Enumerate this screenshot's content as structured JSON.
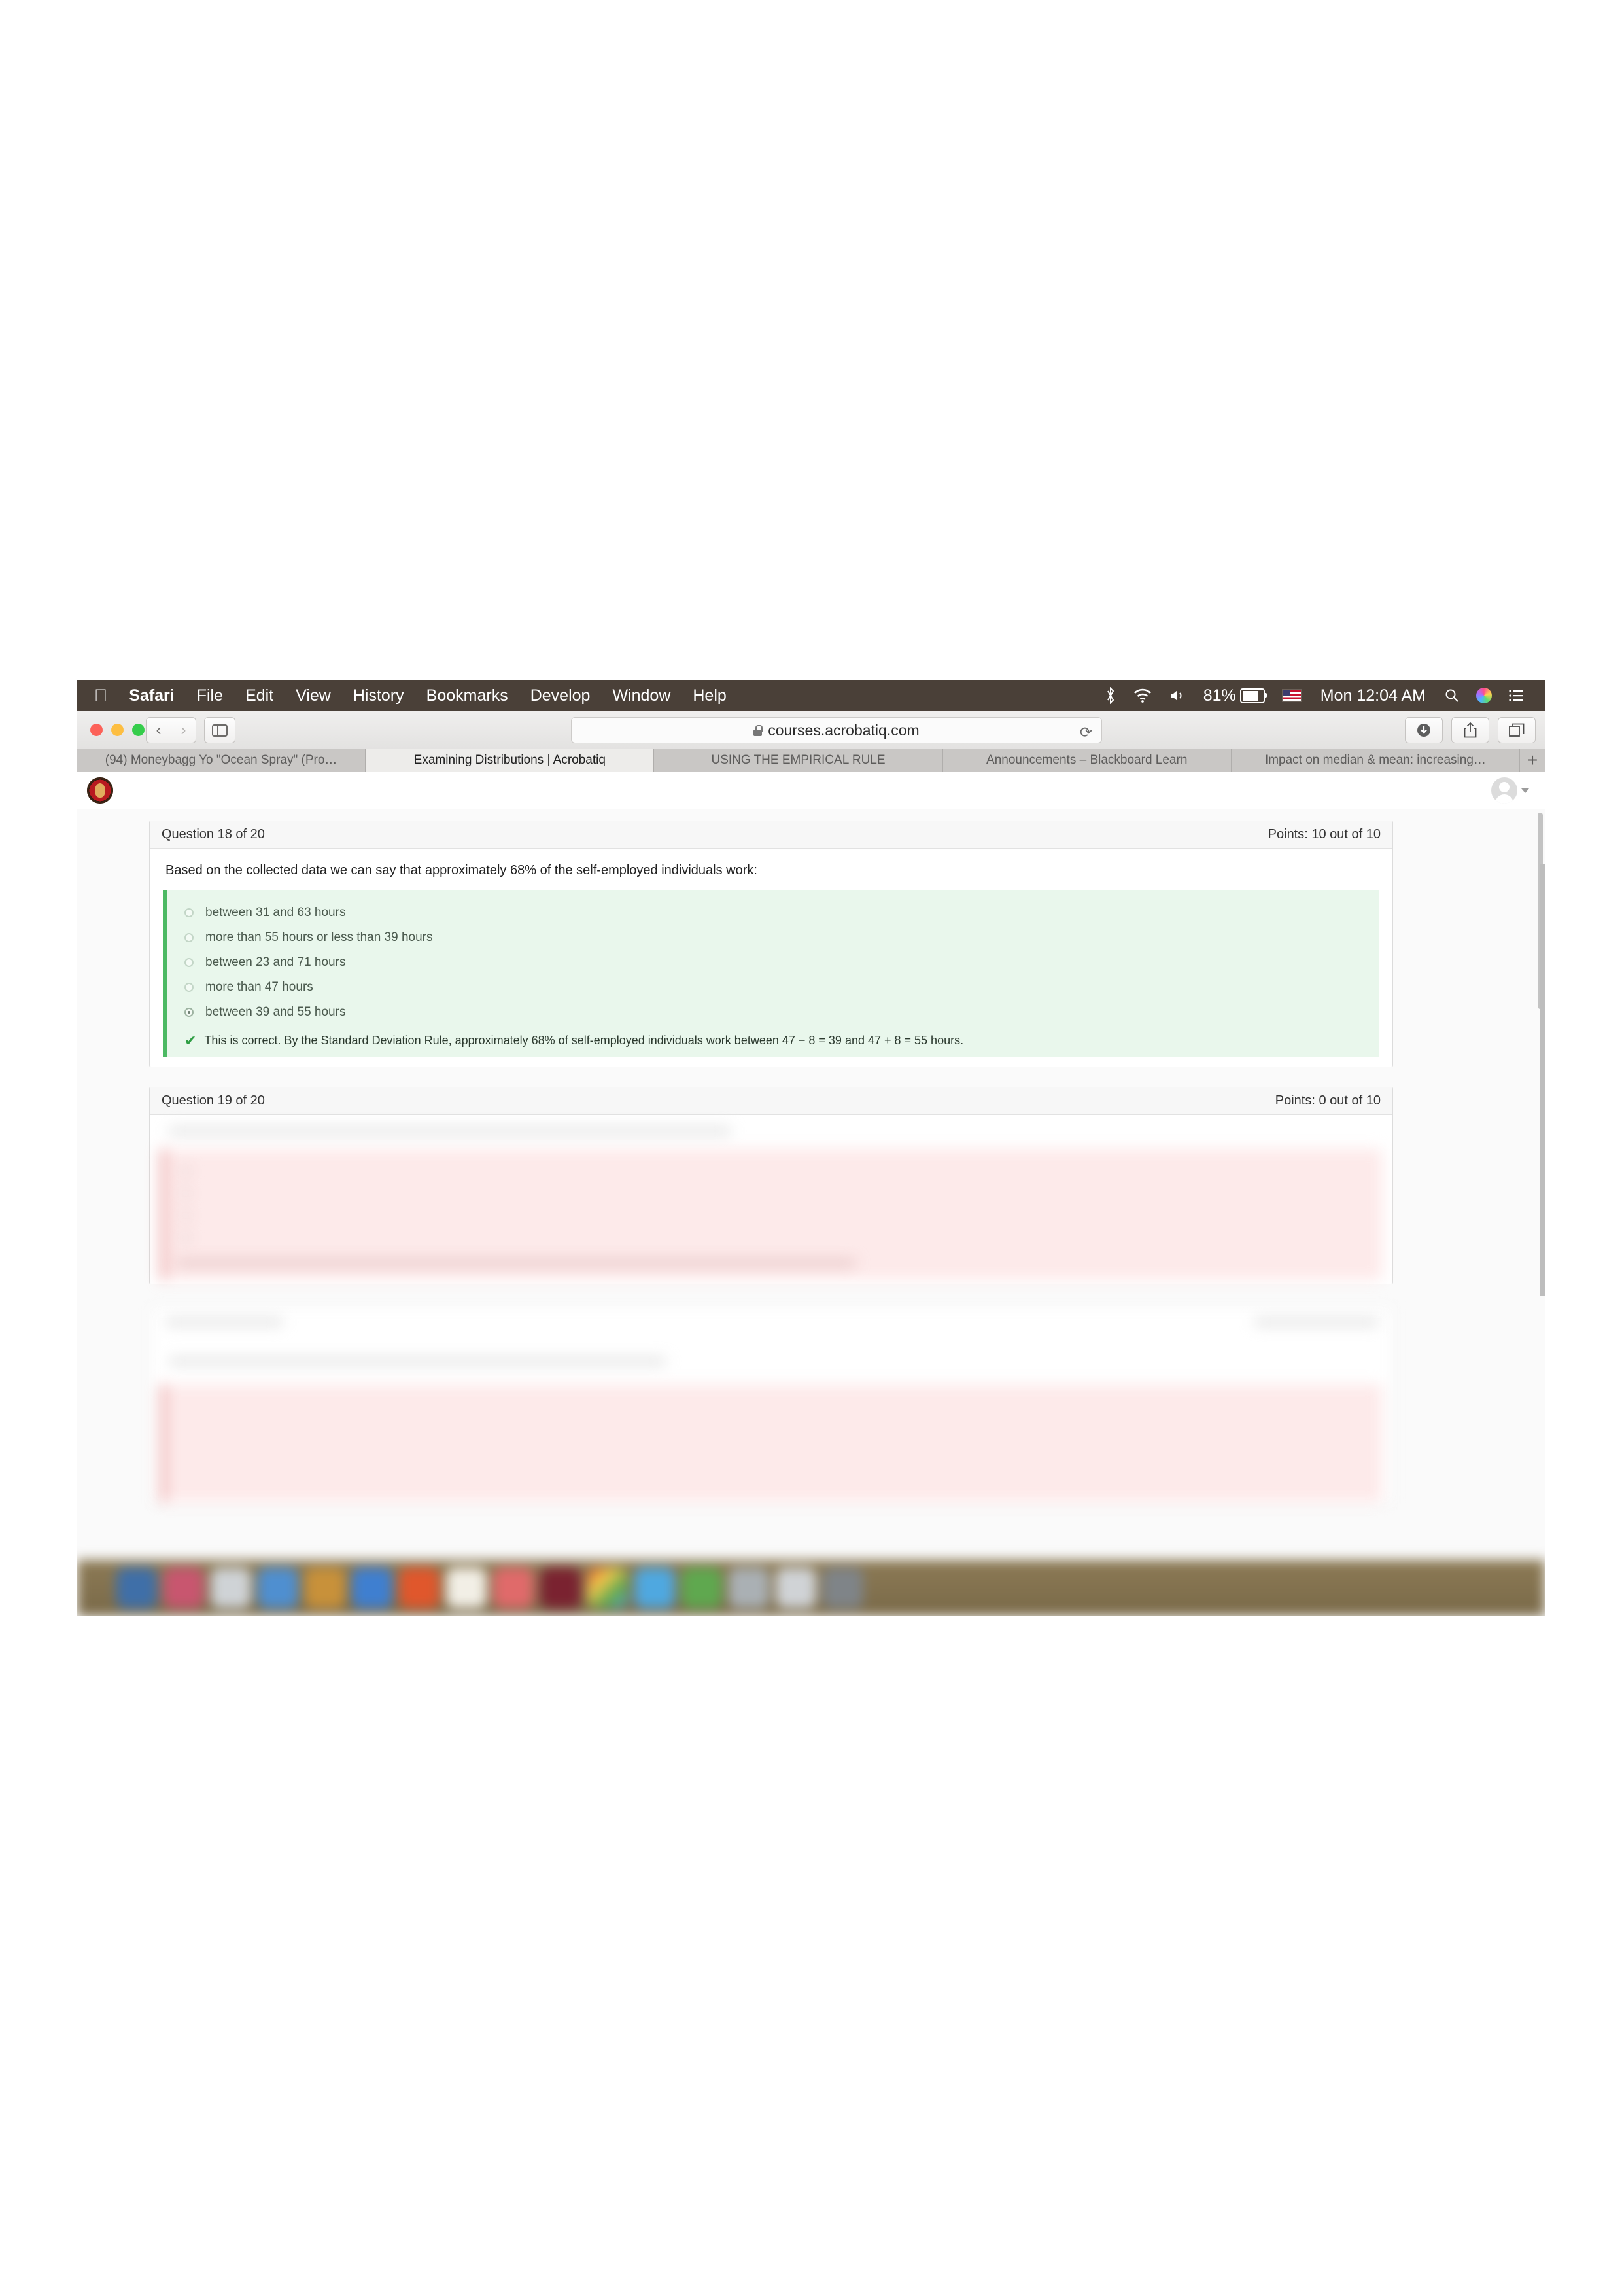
{
  "menubar": {
    "apple_icon": "apple-icon",
    "items": [
      "Safari",
      "File",
      "Edit",
      "View",
      "History",
      "Bookmarks",
      "Develop",
      "Window",
      "Help"
    ],
    "status": {
      "bluetooth_icon": "bluetooth-icon",
      "wifi_icon": "wifi-icon",
      "volume_icon": "volume-icon",
      "battery_percent": "81%",
      "battery_icon": "battery-icon",
      "flag_icon": "us-flag-icon",
      "clock": "Mon 12:04 AM",
      "search_icon": "spotlight-search-icon",
      "siri_icon": "siri-icon",
      "notifications_icon": "notification-center-icon"
    }
  },
  "browser": {
    "window_controls": [
      "close",
      "minimize",
      "zoom"
    ],
    "back_icon": "back-chevron-icon",
    "forward_icon": "forward-chevron-icon",
    "sidebar_icon": "sidebar-toggle-icon",
    "url": "courses.acrobatiq.com",
    "lock_icon": "secure-lock-icon",
    "reload_icon": "reload-icon",
    "downloads_icon": "downloads-icon",
    "share_icon": "share-icon",
    "tabs_overview_icon": "tab-overview-icon",
    "new_tab_label": "+",
    "tabs": [
      {
        "label": "(94) Moneybagg Yo \"Ocean Spray\" (Pro…",
        "active": false
      },
      {
        "label": "Examining Distributions | Acrobatiq",
        "active": true
      },
      {
        "label": "USING THE EMPIRICAL RULE",
        "active": false
      },
      {
        "label": "Announcements – Blackboard Learn",
        "active": false
      },
      {
        "label": "Impact on median & mean: increasing…",
        "active": false
      }
    ]
  },
  "site_header": {
    "logo_icon": "university-seal-logo",
    "avatar_icon": "user-avatar-icon",
    "account_caret_icon": "chevron-down-icon"
  },
  "questions": [
    {
      "header": "Question 18 of 20",
      "points": "Points: 10 out of 10",
      "stem": "Based on the collected data we can say that approximately 68% of the self-employed individuals work:",
      "state": "correct",
      "options": [
        {
          "label": "between 31 and 63 hours",
          "selected": false
        },
        {
          "label": "more than 55 hours or less than 39 hours",
          "selected": false
        },
        {
          "label": "between 23 and 71 hours",
          "selected": false
        },
        {
          "label": "more than 47 hours",
          "selected": false
        },
        {
          "label": "between 39 and 55 hours",
          "selected": true
        }
      ],
      "feedback_icon": "check-mark-icon",
      "feedback": "This is correct. By the Standard Deviation Rule, approximately 68% of self-employed individuals work between 47 − 8 = 39 and 47 + 8 = 55 hours."
    },
    {
      "header": "Question 19 of 20",
      "points": "Points: 0 out of 10",
      "state": "incorrect-blurred"
    }
  ],
  "colors": {
    "correct_accent": "#4cb963",
    "correct_bg": "#e9f7ec",
    "incorrect_bg": "#fdeaea",
    "incorrect_accent": "#e79494",
    "menubar_bg": "#4a4038",
    "tab_bg": "#c9c7c5",
    "tab_active_bg": "#edecea"
  },
  "scrollbar": {
    "vertical_thumb": "vertical-scrollbar-thumb"
  },
  "dock": {
    "icon_colors": [
      "#3f6fa8",
      "#c8566f",
      "#cfd3d6",
      "#4f8fd0",
      "#c8913a",
      "#3f7fd0",
      "#e0572c",
      "#f2efe6",
      "#e06a6a",
      "#7a2230",
      "#5fa84f",
      "#4fa8e0",
      "#aab0b4",
      "#7f8488",
      "#d0d3d6"
    ]
  }
}
